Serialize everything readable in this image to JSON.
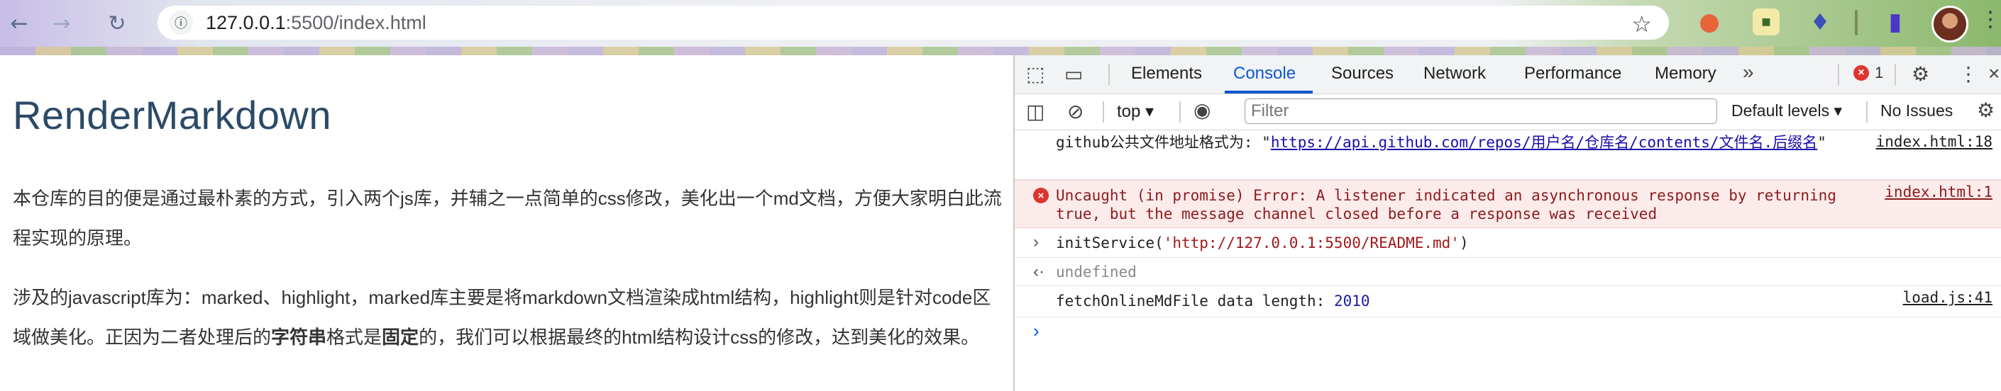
{
  "browser": {
    "url_host": "127.0.0.1",
    "url_rest": ":5500/index.html"
  },
  "page": {
    "title": "RenderMarkdown",
    "p1": "本仓库的目的便是通过最朴素的方式，引入两个js库，并辅之一点简单的css修改，美化出一个md文档，方便大家明白此流程实现的原理。",
    "p2_a": "涉及的javascript库为：marked、highlight，marked库主要是将markdown文档渲染成html结构，highlight则是针对code区域做美化。正因为二者处理后的",
    "p2_b1": "字符串",
    "p2_c": "格式是",
    "p2_b2": "固定",
    "p2_d": "的，我们可以根据最终的html结构设计css的修改，达到美化的效果。"
  },
  "devtools": {
    "tabs": [
      "Elements",
      "Console",
      "Sources",
      "Network",
      "Performance",
      "Memory"
    ],
    "error_count": "1",
    "context": "top",
    "filter_placeholder": "Filter",
    "levels": "Default levels",
    "issues": "No Issues",
    "console": {
      "row1_label": "github公共文件地址格式为:  ",
      "row1_quote_open": "\"",
      "row1_link": "https://api.github.com/repos/用户名/仓库名/contents/文件名.后缀名",
      "row1_quote_close": "\"",
      "row1_src": "index.html:18",
      "row2_msg": "Uncaught (in promise) Error: A listener indicated an asynchronous response by returning true, but the message channel closed before a response was received",
      "row2_src": "index.html:1",
      "row3_fn": "initService(",
      "row3_arg": "'http://127.0.0.1:5500/README.md'",
      "row3_close": ")",
      "row4_result": "undefined",
      "row5_label": "fetchOnlineMdFile data length: ",
      "row5_value": "2010",
      "row5_src": "load.js:41"
    }
  }
}
